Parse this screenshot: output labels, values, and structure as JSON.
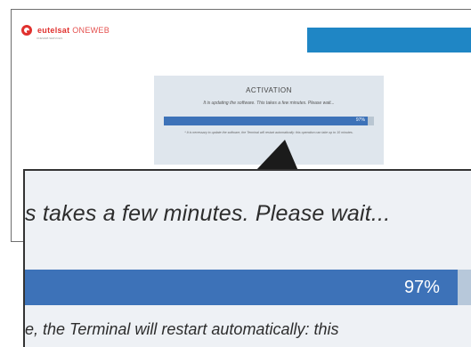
{
  "brand": {
    "name_bold": "eutelsat",
    "name_light": "ONEWEB",
    "subtitle": "ONEWEB SERVICES",
    "brand_color": "#e0312e",
    "header_color": "#1f86c5"
  },
  "activation": {
    "title": "ACTIVATION",
    "message": "It is updating the software. This takes a few minutes. Please wait...",
    "progress_percent": 97,
    "progress_label": "97%",
    "note": "* It is necessary to update the software, the Terminal will restart automatically: this operation can take up to 10 minutes."
  },
  "callout": {
    "message_fragment": "s takes a few minutes. Please wait...",
    "progress_label": "97%",
    "note_fragment": "e, the Terminal will restart automatically: this"
  },
  "colors": {
    "card_bg": "#dfe6ed",
    "progress_fill": "#3d72b8",
    "progress_track": "#b9c6d2"
  }
}
